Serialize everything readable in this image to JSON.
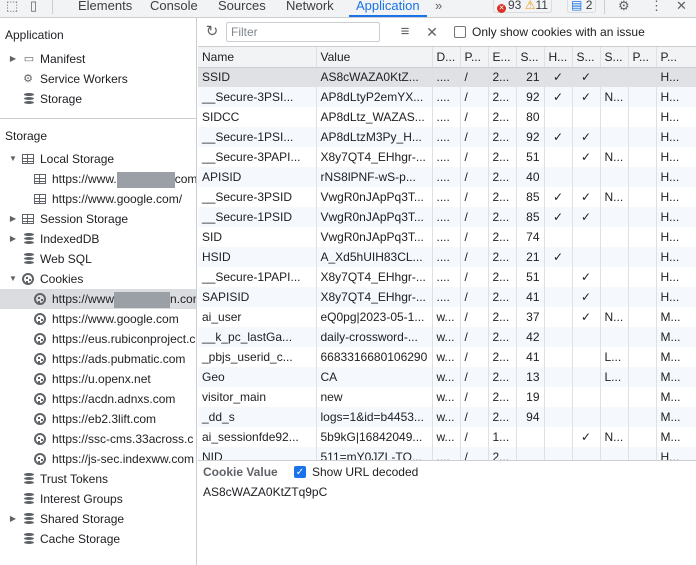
{
  "topbar": {
    "tabs": [
      "Elements",
      "Console",
      "Sources",
      "Network",
      "Application"
    ],
    "active_tab": "Application",
    "more": "»",
    "errors": "93",
    "warnings": "11",
    "messages": "2"
  },
  "sidebar": {
    "application_title": "Application",
    "application_items": [
      "Manifest",
      "Service Workers",
      "Storage"
    ],
    "storage_title": "Storage",
    "local_storage": "Local Storage",
    "local_storage_children": [
      "https://www.",
      "https://www.google.com/"
    ],
    "local_storage_suffix": "com",
    "session_storage": "Session Storage",
    "indexeddb": "IndexedDB",
    "websql": "Web SQL",
    "cookies": "Cookies",
    "cookie_children": [
      "https://www",
      "https://www.google.com",
      "https://eus.rubiconproject.c",
      "https://ads.pubmatic.com",
      "https://u.openx.net",
      "https://acdn.adnxs.com",
      "https://eb2.3lift.com",
      "https://ssc-cms.33across.c",
      "https://js-sec.indexww.com"
    ],
    "cookie_first_suffix": "n.com",
    "bottom_items": [
      "Trust Tokens",
      "Interest Groups",
      "Shared Storage",
      "Cache Storage"
    ]
  },
  "toolbar": {
    "filter_placeholder": "Filter",
    "only_issue_label": "Only show cookies with an issue"
  },
  "table": {
    "columns": [
      "Name",
      "Value",
      "D...",
      "P...",
      "E...",
      "S...",
      "H...",
      "S...",
      "S...",
      "P...",
      "P..."
    ],
    "rows": [
      [
        "SSID",
        "AS8cWAZA0KtZ...",
        "....",
        "/",
        "2...",
        "21",
        "✓",
        "✓",
        "",
        "",
        "H..."
      ],
      [
        "__Secure-3PSI...",
        "AP8dLtyP2emYX...",
        "....",
        "/",
        "2...",
        "92",
        "✓",
        "✓",
        "N...",
        "",
        "H..."
      ],
      [
        "SIDCC",
        "AP8dLtz_WAZAS...",
        "....",
        "/",
        "2...",
        "80",
        "",
        "",
        "",
        "",
        "H..."
      ],
      [
        "__Secure-1PSI...",
        "AP8dLtzM3Py_H...",
        "....",
        "/",
        "2...",
        "92",
        "✓",
        "✓",
        "",
        "",
        "H..."
      ],
      [
        "__Secure-3PAPI...",
        "X8y7QT4_EHhgr-...",
        "....",
        "/",
        "2...",
        "51",
        "",
        "✓",
        "N...",
        "",
        "H..."
      ],
      [
        "APISID",
        "rNS8lPNF-wS-p...",
        "....",
        "/",
        "2...",
        "40",
        "",
        "",
        "",
        "",
        "H..."
      ],
      [
        "__Secure-3PSID",
        "VwgR0nJApPq3T...",
        "....",
        "/",
        "2...",
        "85",
        "✓",
        "✓",
        "N...",
        "",
        "H..."
      ],
      [
        "__Secure-1PSID",
        "VwgR0nJApPq3T...",
        "....",
        "/",
        "2...",
        "85",
        "✓",
        "✓",
        "",
        "",
        "H..."
      ],
      [
        "SID",
        "VwgR0nJApPq3T...",
        "....",
        "/",
        "2...",
        "74",
        "",
        "",
        "",
        "",
        "H..."
      ],
      [
        "HSID",
        "A_Xd5hUIH83CL...",
        "....",
        "/",
        "2...",
        "21",
        "✓",
        "",
        "",
        "",
        "H..."
      ],
      [
        "__Secure-1PAPI...",
        "X8y7QT4_EHhgr-...",
        "....",
        "/",
        "2...",
        "51",
        "",
        "✓",
        "",
        "",
        "H..."
      ],
      [
        "SAPISID",
        "X8y7QT4_EHhgr-...",
        "....",
        "/",
        "2...",
        "41",
        "",
        "✓",
        "",
        "",
        "H..."
      ],
      [
        "ai_user",
        "eQ0pg|2023-05-1...",
        "w...",
        "/",
        "2...",
        "37",
        "",
        "✓",
        "N...",
        "",
        "M..."
      ],
      [
        "__k_pc_lastGa...",
        "daily-crossword-...",
        "w...",
        "/",
        "2...",
        "42",
        "",
        "",
        "",
        "",
        "M..."
      ],
      [
        "_pbjs_userid_c...",
        "6683316680106290",
        "w...",
        "/",
        "2...",
        "41",
        "",
        "",
        "L...",
        "",
        "M..."
      ],
      [
        "Geo",
        "CA",
        "w...",
        "/",
        "2...",
        "13",
        "",
        "",
        "L...",
        "",
        "M..."
      ],
      [
        "visitor_main",
        "new",
        "w...",
        "/",
        "2...",
        "19",
        "",
        "",
        "",
        "",
        "M..."
      ],
      [
        "_dd_s",
        "logs=1&id=b4453...",
        "w...",
        "/",
        "2...",
        "94",
        "",
        "",
        "",
        "",
        "M..."
      ],
      [
        "ai_sessionfde92...",
        "5b9kG|16842049...",
        "w...",
        "/",
        "1...",
        "",
        "",
        "✓",
        "N...",
        "",
        "M..."
      ],
      [
        "NID",
        "511=mY0JZL-TQ...",
        "....",
        "/",
        "2...",
        "",
        "",
        "",
        "",
        "",
        "H..."
      ]
    ]
  },
  "cookie_value": {
    "title": "Cookie Value",
    "show_decoded_label": "Show URL decoded",
    "value": "AS8cWAZA0KtZTq9pC"
  }
}
